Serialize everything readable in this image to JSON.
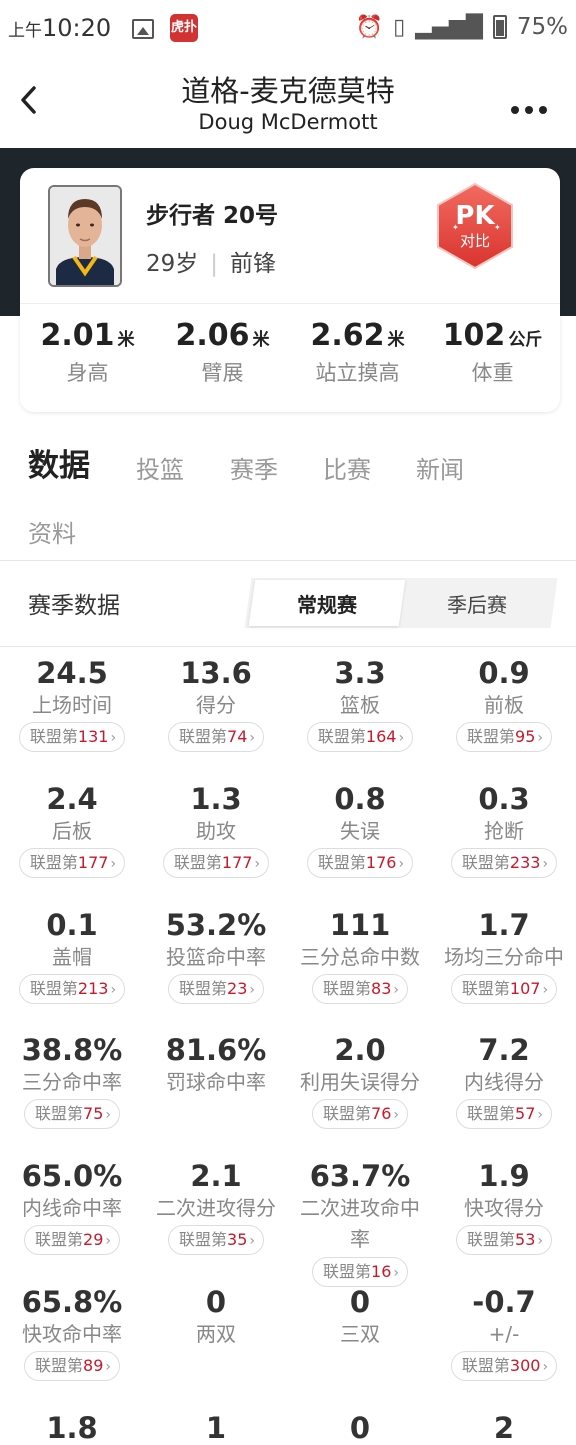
{
  "status_bar": {
    "time_prefix": "上午",
    "time": "10:20",
    "app_badge": "虎扑",
    "battery": "75%"
  },
  "nav": {
    "back_icon": "chevron-left-icon",
    "title_cn": "道格-麦克德莫特",
    "title_en": "Doug McDermott",
    "more_icon": "more-dots-icon"
  },
  "player": {
    "team_number": "步行者 20号",
    "age": "29岁",
    "position": "前锋",
    "pk_label": "PK",
    "pk_sub": "对比",
    "measurements": [
      {
        "value": "2.01",
        "unit": "米",
        "label": "身高"
      },
      {
        "value": "2.06",
        "unit": "米",
        "label": "臂展"
      },
      {
        "value": "2.62",
        "unit": "米",
        "label": "站立摸高"
      },
      {
        "value": "102",
        "unit": "公斤",
        "label": "体重"
      }
    ]
  },
  "tabs": [
    {
      "label": "数据",
      "active": true
    },
    {
      "label": "投篮",
      "active": false
    },
    {
      "label": "赛季",
      "active": false
    },
    {
      "label": "比赛",
      "active": false
    },
    {
      "label": "新闻",
      "active": false
    },
    {
      "label": "资料",
      "active": false
    }
  ],
  "season": {
    "title": "赛季数据",
    "segments": [
      "常规赛",
      "季后赛"
    ],
    "active_segment": "常规赛"
  },
  "rank_prefix": "联盟第",
  "stats": [
    {
      "value": "24.5",
      "label": "上场时间",
      "rank": "131"
    },
    {
      "value": "13.6",
      "label": "得分",
      "rank": "74"
    },
    {
      "value": "3.3",
      "label": "篮板",
      "rank": "164"
    },
    {
      "value": "0.9",
      "label": "前板",
      "rank": "95"
    },
    {
      "value": "2.4",
      "label": "后板",
      "rank": "177"
    },
    {
      "value": "1.3",
      "label": "助攻",
      "rank": "177"
    },
    {
      "value": "0.8",
      "label": "失误",
      "rank": "176"
    },
    {
      "value": "0.3",
      "label": "抢断",
      "rank": "233"
    },
    {
      "value": "0.1",
      "label": "盖帽",
      "rank": "213"
    },
    {
      "value": "53.2%",
      "label": "投篮命中率",
      "rank": "23"
    },
    {
      "value": "111",
      "label": "三分总命中数",
      "rank": "83"
    },
    {
      "value": "1.7",
      "label": "场均三分命中",
      "rank": "107"
    },
    {
      "value": "38.8%",
      "label": "三分命中率",
      "rank": "75"
    },
    {
      "value": "81.6%",
      "label": "罚球命中率",
      "rank": ""
    },
    {
      "value": "2.0",
      "label": "利用失误得分",
      "rank": "76"
    },
    {
      "value": "7.2",
      "label": "内线得分",
      "rank": "57"
    },
    {
      "value": "65.0%",
      "label": "内线命中率",
      "rank": "29"
    },
    {
      "value": "2.1",
      "label": "二次进攻得分",
      "rank": "35"
    },
    {
      "value": "63.7%",
      "label": "二次进攻命中率",
      "rank": "16"
    },
    {
      "value": "1.9",
      "label": "快攻得分",
      "rank": "53"
    },
    {
      "value": "65.8%",
      "label": "快攻命中率",
      "rank": "89"
    },
    {
      "value": "0",
      "label": "两双",
      "rank": ""
    },
    {
      "value": "0",
      "label": "三双",
      "rank": ""
    },
    {
      "value": "-0.7",
      "label": "+/-",
      "rank": "300"
    },
    {
      "value": "1.8",
      "label": "",
      "rank": ""
    },
    {
      "value": "1",
      "label": "",
      "rank": ""
    },
    {
      "value": "0",
      "label": "",
      "rank": ""
    },
    {
      "value": "2",
      "label": "",
      "rank": ""
    }
  ]
}
